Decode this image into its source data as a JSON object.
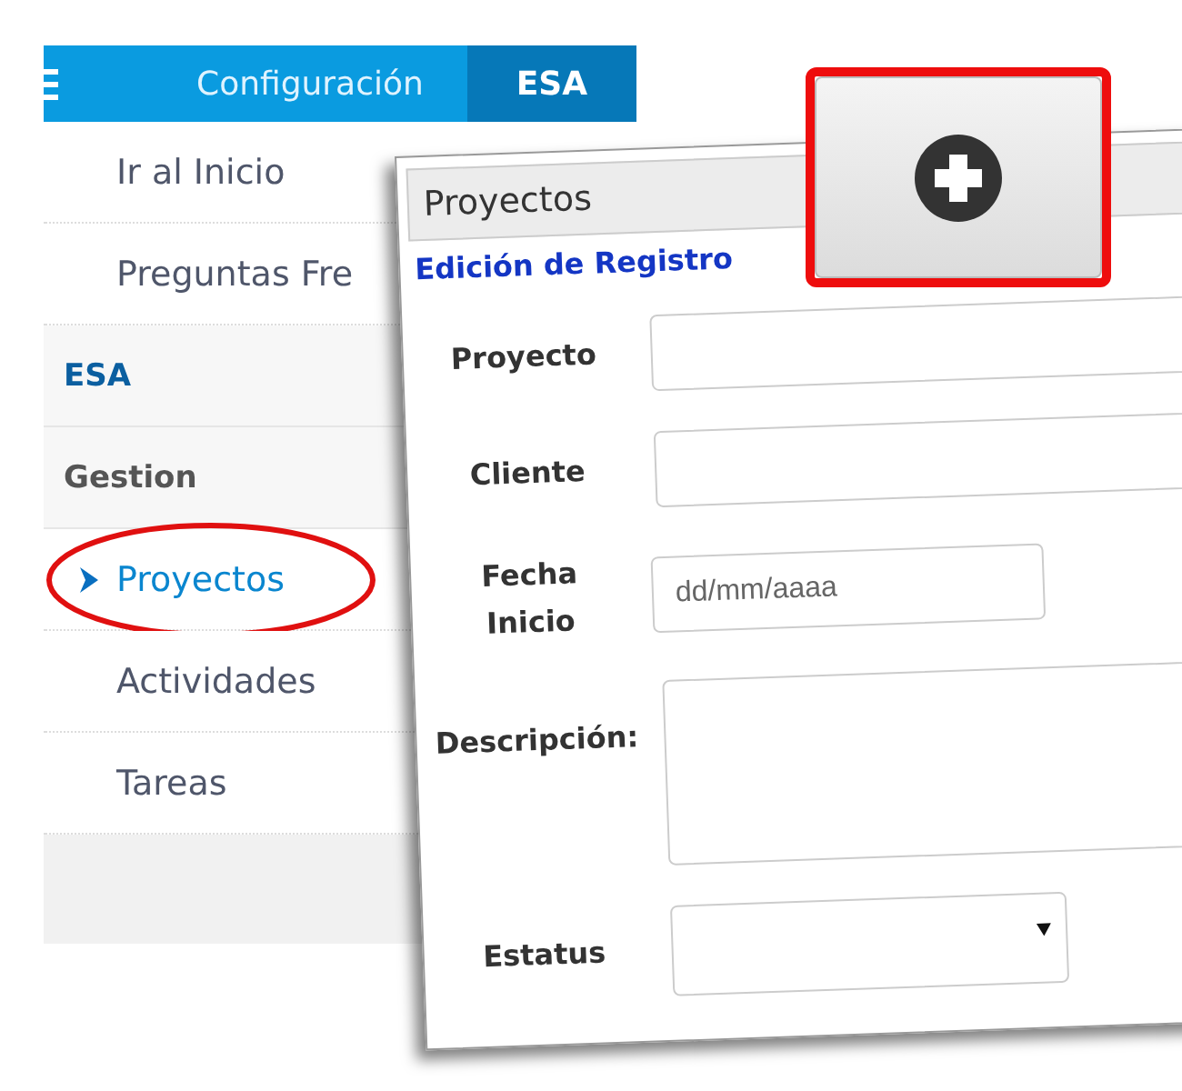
{
  "topbar": {
    "tabs": [
      {
        "label": "Configuración",
        "selected": false
      },
      {
        "label": "ESA",
        "selected": true
      }
    ]
  },
  "sidebar": {
    "items": [
      {
        "kind": "link",
        "label": "Ir al Inicio",
        "selected": false,
        "circled": false
      },
      {
        "kind": "link",
        "label": "Preguntas Fre",
        "selected": false,
        "circled": false
      },
      {
        "kind": "section",
        "label": "ESA"
      },
      {
        "kind": "group",
        "label": "Gestion"
      },
      {
        "kind": "link",
        "label": "Proyectos",
        "selected": true,
        "circled": true
      },
      {
        "kind": "link",
        "label": "Actividades",
        "selected": false,
        "circled": false
      },
      {
        "kind": "link",
        "label": "Tareas",
        "selected": false,
        "circled": false
      }
    ]
  },
  "form": {
    "title": "Proyectos",
    "subtitle": "Edición de Registro",
    "fields": [
      {
        "kind": "text",
        "label": "Proyecto"
      },
      {
        "kind": "text",
        "label": "Cliente"
      },
      {
        "kind": "date",
        "label": "Fecha Inicio",
        "placeholder": "dd/mm/aaaa"
      },
      {
        "kind": "textarea",
        "label": "Descripción:"
      },
      {
        "kind": "select",
        "label": "Estatus"
      }
    ]
  },
  "add_button": {
    "highlighted": true
  }
}
